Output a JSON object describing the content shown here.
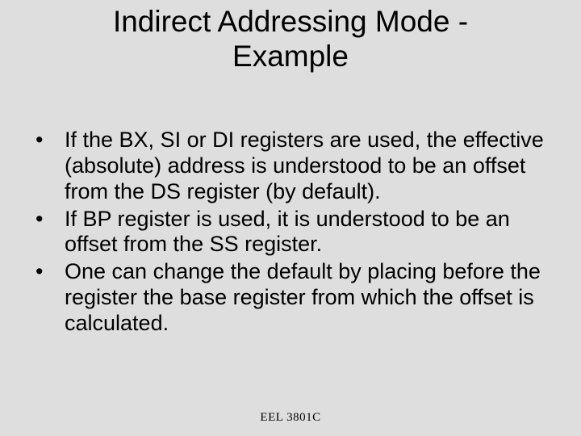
{
  "title_line1": "Indirect Addressing Mode -",
  "title_line2": "Example",
  "bullets": [
    "If the BX, SI or DI registers are used, the effective (absolute) address is understood to be an offset from the DS register (by default).",
    "If BP register is used, it is understood to be an offset from the SS register.",
    "One can change the default by placing before the register the base register from which the offset is calculated."
  ],
  "footer": "EEL 3801C"
}
